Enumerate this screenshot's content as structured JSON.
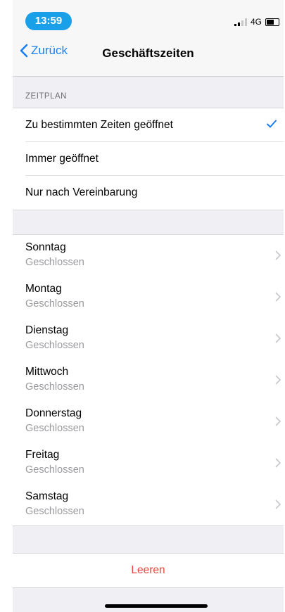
{
  "status_bar": {
    "time": "13:59",
    "network": "4G"
  },
  "nav": {
    "back_label": "Zurück",
    "title": "Geschäftszeiten"
  },
  "schedule": {
    "header": "ZEITPLAN",
    "options": [
      {
        "label": "Zu bestimmten Zeiten geöffnet",
        "selected": true
      },
      {
        "label": "Immer geöffnet",
        "selected": false
      },
      {
        "label": "Nur nach Vereinbarung",
        "selected": false
      }
    ]
  },
  "days": [
    {
      "name": "Sonntag",
      "status": "Geschlossen"
    },
    {
      "name": "Montag",
      "status": "Geschlossen"
    },
    {
      "name": "Dienstag",
      "status": "Geschlossen"
    },
    {
      "name": "Mittwoch",
      "status": "Geschlossen"
    },
    {
      "name": "Donnerstag",
      "status": "Geschlossen"
    },
    {
      "name": "Freitag",
      "status": "Geschlossen"
    },
    {
      "name": "Samstag",
      "status": "Geschlossen"
    }
  ],
  "actions": {
    "clear_label": "Leeren"
  },
  "colors": {
    "accent": "#1a7ff5",
    "destructive": "#e8463e",
    "time_pill": "#1aa0e8"
  },
  "icons": {
    "back": "chevron-left-icon",
    "check": "checkmark-icon",
    "disclosure": "chevron-right-icon"
  }
}
